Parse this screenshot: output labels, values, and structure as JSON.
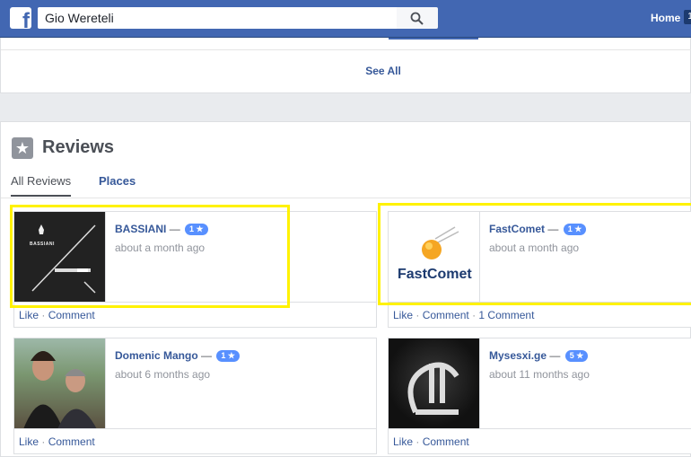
{
  "header": {
    "logo": "f",
    "search_value": "Gio Wereteli",
    "home_label": "Home",
    "home_badge": "1"
  },
  "see_all_label": "See All",
  "reviews": {
    "title": "Reviews",
    "tabs": [
      "All Reviews",
      "Places"
    ],
    "items": [
      {
        "name": "BASSIANI",
        "dash": "—",
        "rating": "1 ★",
        "time": "about a month ago",
        "like": "Like",
        "comment": "Comment",
        "extra": "",
        "logo_text": "BASSIANI"
      },
      {
        "name": "FastComet",
        "dash": "—",
        "rating": "1 ★",
        "time": "about a month ago",
        "like": "Like",
        "comment": "Comment",
        "extra": "1 Comment",
        "logo_text": "FastComet"
      },
      {
        "name": "Domenic Mango",
        "dash": "—",
        "rating": "1 ★",
        "time": "about 6 months ago",
        "like": "Like",
        "comment": "Comment",
        "extra": ""
      },
      {
        "name": "Mysesxi.ge",
        "dash": "—",
        "rating": "5 ★",
        "time": "about 11 months ago",
        "like": "Like",
        "comment": "Comment",
        "extra": ""
      }
    ]
  },
  "colors": {
    "brand": "#4267b2",
    "link": "#365899",
    "highlight": "#fff200",
    "rating_pill": "#5890ff"
  }
}
